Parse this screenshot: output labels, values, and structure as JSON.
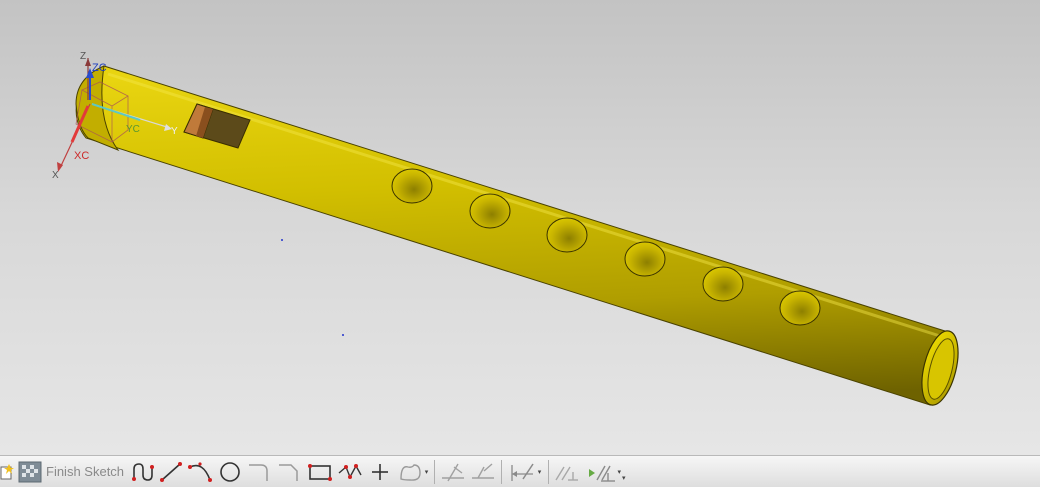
{
  "csys": {
    "triad_labels": {
      "z": "Z",
      "zc": "ZC",
      "y": "Y",
      "yc": "YC",
      "x": "X",
      "xc": "XC"
    }
  },
  "model": {
    "body_color": "#c8b400",
    "finger_hole_count": 6
  },
  "toolbar": {
    "finish_sketch_label": "Finish Sketch",
    "icons": [
      "new-sketch-icon",
      "finish-sketch-flag-icon",
      "profile-icon",
      "line-icon",
      "arc-icon",
      "circle-icon",
      "fillet-icon",
      "chamfer-icon",
      "rectangle-icon",
      "polygon-icon",
      "point-icon",
      "studio-spline-icon",
      "quick-trim-icon",
      "quick-extend-icon",
      "rapid-dimension-icon",
      "geometric-constraints-icon",
      "show-constraints-icon"
    ]
  }
}
